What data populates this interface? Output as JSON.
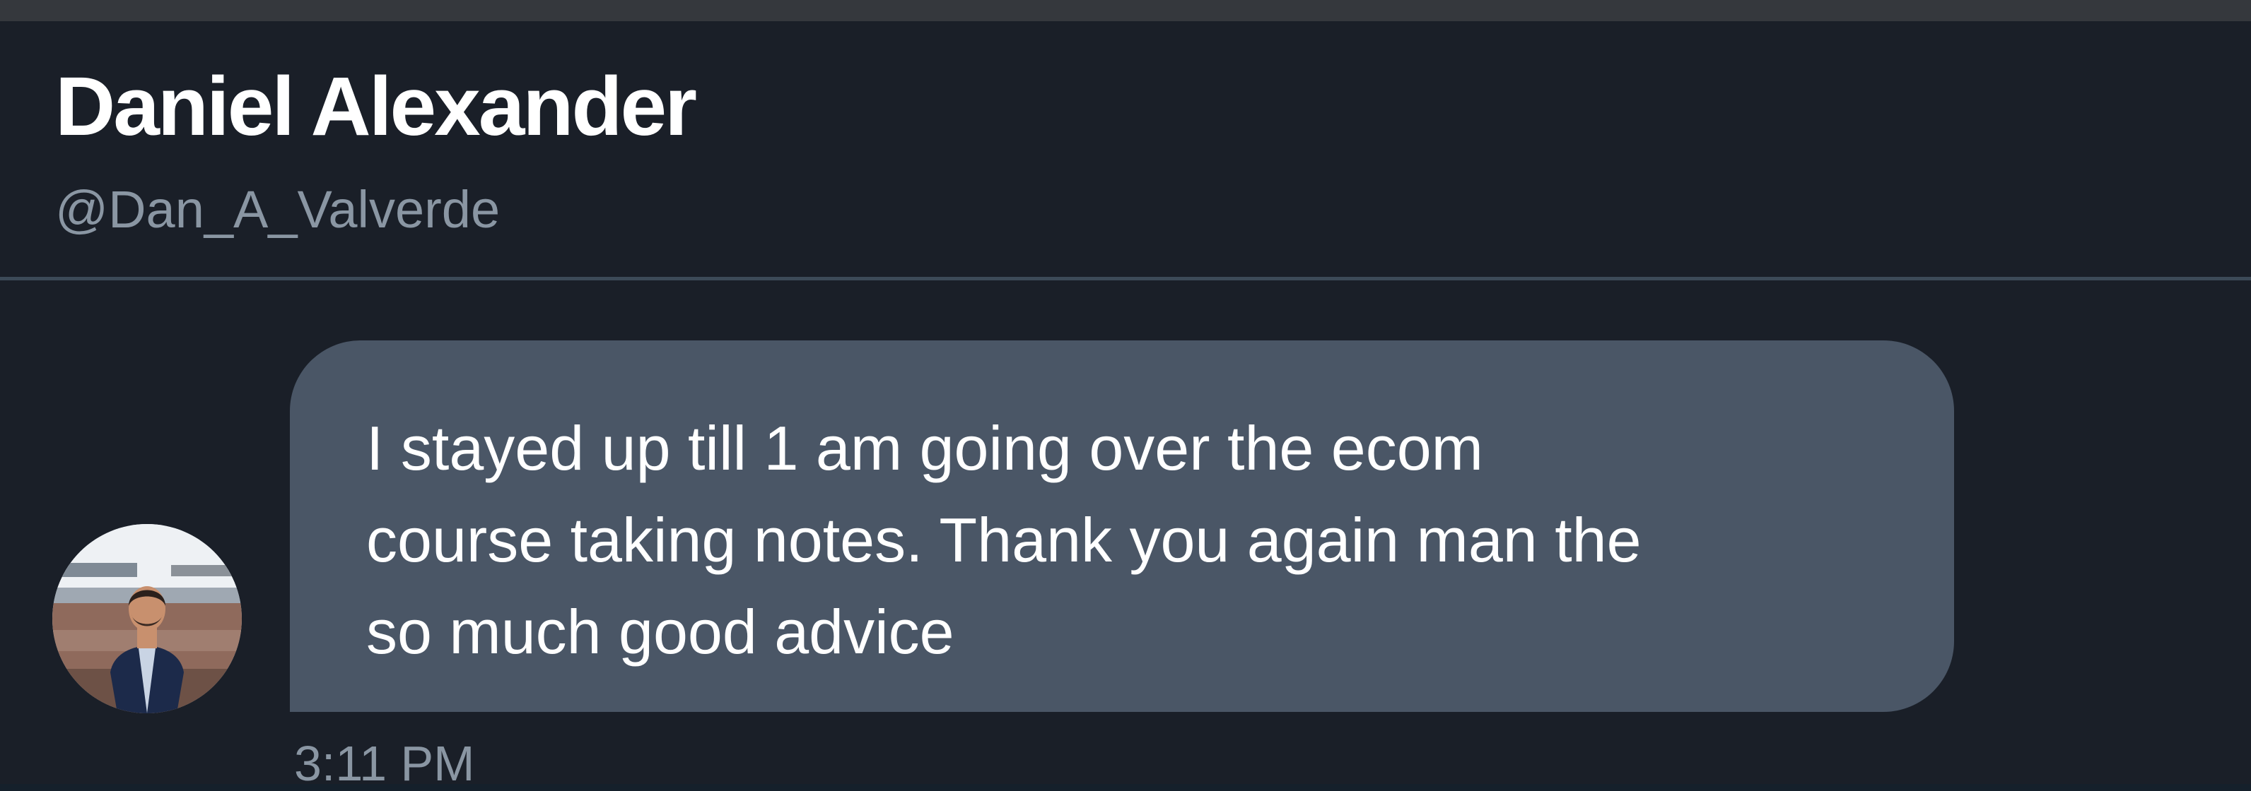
{
  "profile": {
    "display_name": "Daniel Alexander",
    "handle": "@Dan_A_Valverde"
  },
  "message": {
    "lines": [
      "I stayed up till 1 am going over the ecom",
      "course taking notes. Thank you again man the",
      "so much good advice"
    ],
    "timestamp": "3:11 PM"
  },
  "colors": {
    "background": "#1a1f28",
    "bubble": "#4a5666",
    "secondary_text": "#8a96a3",
    "divider": "#3c4a58"
  }
}
